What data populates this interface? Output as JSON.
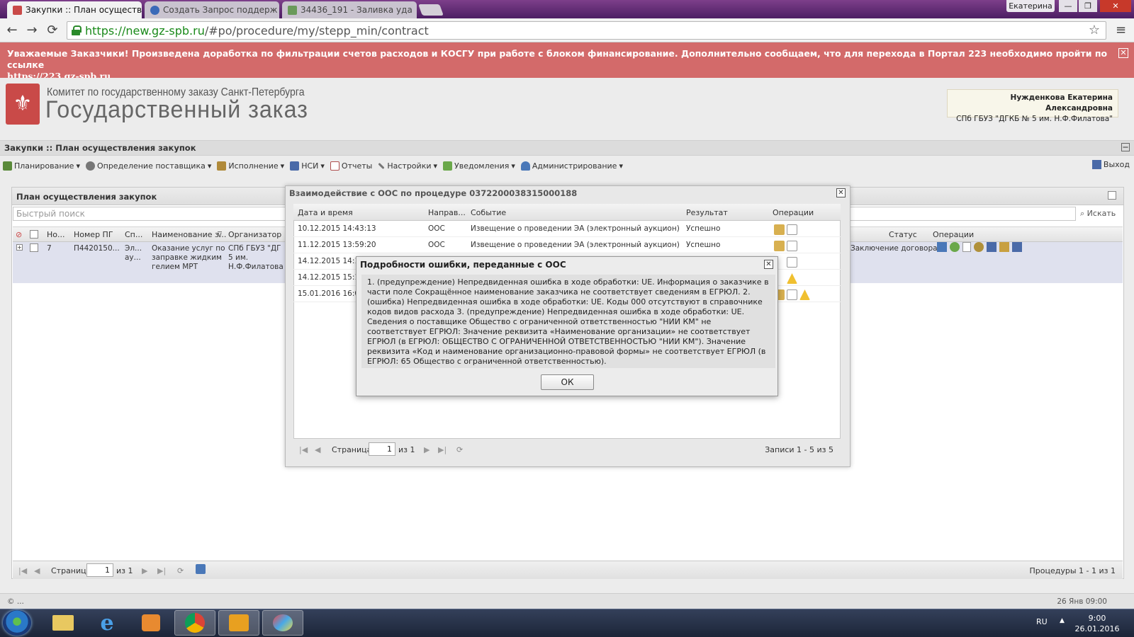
{
  "browser": {
    "tabs": [
      {
        "title": "Закупки :: План осуществ",
        "close": "✕"
      },
      {
        "title": "Создать Запрос поддерж",
        "close": "✕"
      },
      {
        "title": "34436_191 - Заливка уда",
        "close": "✕"
      }
    ],
    "profile": "Екатерина",
    "window_controls": [
      "—",
      "❐",
      "✕"
    ],
    "nav": {
      "back": "←",
      "forward": "→",
      "reload": "⟳"
    },
    "url_scheme": "https://",
    "url_host": "new.gz-spb.ru",
    "url_path": "/#po/procedure/my/stepp_min/contract",
    "bookmark_icon": "☆",
    "menu_icon": "≡"
  },
  "banner": {
    "text": "Уважаемые Заказчики! Произведена доработка по фильтрации счетов расходов и КОСГУ при работе с блоком финансирование. Дополнительно сообщаем, что для перехода в Портал 223 необходимо пройти по ссылке",
    "link": "https://223.gz-spb.ru",
    "close": "✕"
  },
  "header": {
    "logo_glyph": "⚜",
    "org": "Комитет по государственному заказу Санкт-Петербурга",
    "title": "Государственный заказ",
    "user_name": "Нужденкова Екатерина Александровна",
    "user_org": "СПб ГБУЗ \"ДГКБ № 5 им. Н.Ф.Филатова\""
  },
  "breadcrumb": "Закупки :: План осуществления закупок",
  "collapse_icon": "—",
  "menu": {
    "items": [
      {
        "label": "Планирование",
        "arrow": "▾",
        "color": "#5a8a3a"
      },
      {
        "label": "Определение поставщика",
        "arrow": "▾",
        "color": "#777"
      },
      {
        "label": "Исполнение",
        "arrow": "▾",
        "color": "#b08a3a"
      },
      {
        "label": "НСИ",
        "arrow": "▾",
        "color": "#4a6aa8"
      },
      {
        "label": "Отчеты",
        "arrow": "",
        "color": "#b05050"
      },
      {
        "label": "Настройки",
        "arrow": "▾",
        "color": "#777"
      },
      {
        "label": "Уведомления",
        "arrow": "▾",
        "color": "#6aa84a"
      },
      {
        "label": "Администрирование",
        "arrow": "▾",
        "color": "#4a78b8"
      }
    ],
    "exit": "Выход"
  },
  "panel": {
    "title": "План осуществления закупок",
    "search_placeholder": "Быстрый поиск",
    "search_btn": "Искать",
    "columns": [
      "Но...",
      "Номер ПГ",
      "Сп...",
      "Наименование з...",
      "Организатор",
      "Статус",
      "Операции"
    ],
    "row": {
      "expand": "+",
      "num": "7",
      "pg": "П4420150...",
      "sp1": "Эл...",
      "sp2": "ау...",
      "name1": "Оказание услуг по",
      "name2": "заправке жидким",
      "name3": "гелием МРТ",
      "org1": "СПб ГБУЗ \"ДГ",
      "org2": "5 им.",
      "org3": "Н.Ф.Филатова",
      "status": "Заключение договора"
    },
    "pager": {
      "page_label": "Страница",
      "page": "1",
      "of": "из 1",
      "summary": "Процедуры 1 - 1 из 1"
    }
  },
  "footer": {
    "left": "© ...",
    "right": "26 Янв 09:00"
  },
  "oos_dialog": {
    "title": "Взаимодействие с ООС по процедуре 0372200038315000188",
    "close": "✕",
    "columns": [
      "Дата и время",
      "Направ...",
      "Событие",
      "Результат",
      "Операции"
    ],
    "rows": [
      {
        "date": "10.12.2015 14:43:13",
        "dir": "ООС",
        "event": "Извещение о проведении ЭА (электронный аукцион)",
        "result": "Успешно"
      },
      {
        "date": "11.12.2015 13:59:20",
        "dir": "ООС",
        "event": "Извещение о проведении ЭА (электронный аукцион)",
        "result": "Успешно"
      },
      {
        "date": "14.12.2015 14:1",
        "dir": "",
        "event": "",
        "result": ""
      },
      {
        "date": "14.12.2015 15:1",
        "dir": "",
        "event": "",
        "result": ""
      },
      {
        "date": "15.01.2016 16:0",
        "dir": "",
        "event": "",
        "result": ""
      }
    ],
    "pager": {
      "page_label": "Страница",
      "page": "1",
      "of": "из 1",
      "summary": "Записи 1 - 5 из 5"
    }
  },
  "error_dialog": {
    "title": "Подробности ошибки, переданные с ООС",
    "close": "✕",
    "body": "1. (предупреждение) Непредвиденная ошибка в ходе обработки: UE. Информация о заказчике в части поле Сокращённое наименование заказчика не соответствует сведениям в ЕГРЮЛ. 2. (ошибка) Непредвиденная ошибка в ходе обработки: UE. Коды 000 отсутствуют в справочнике кодов видов расхода 3. (предупреждение) Непредвиденная ошибка в ходе обработки: UE. Сведения о поставщике Общество с ограниченной ответственностью \"НИИ КМ\" не соответствует ЕГРЮЛ: Значение реквизита «Наименование организации» не соответствует ЕГРЮЛ (в ЕГРЮЛ: ОБЩЕСТВО С ОГРАНИЧЕННОЙ ОТВЕТСТВЕННОСТЬЮ \"НИИ КМ\"). Значение реквизита «Код и наименование организационно-правовой формы» не соответствует ЕГРЮЛ (в ЕГРЮЛ: 65 Общество с ограниченной ответственностью).",
    "ok": "ОК"
  },
  "taskbar": {
    "lang": "RU",
    "tray_arrow": "▲",
    "time": "9:00",
    "date": "26.01.2016",
    "apps": [
      "explorer-icon",
      "ie-icon",
      "media-icon",
      "chrome-icon",
      "outlook-icon",
      "paint-icon"
    ]
  }
}
